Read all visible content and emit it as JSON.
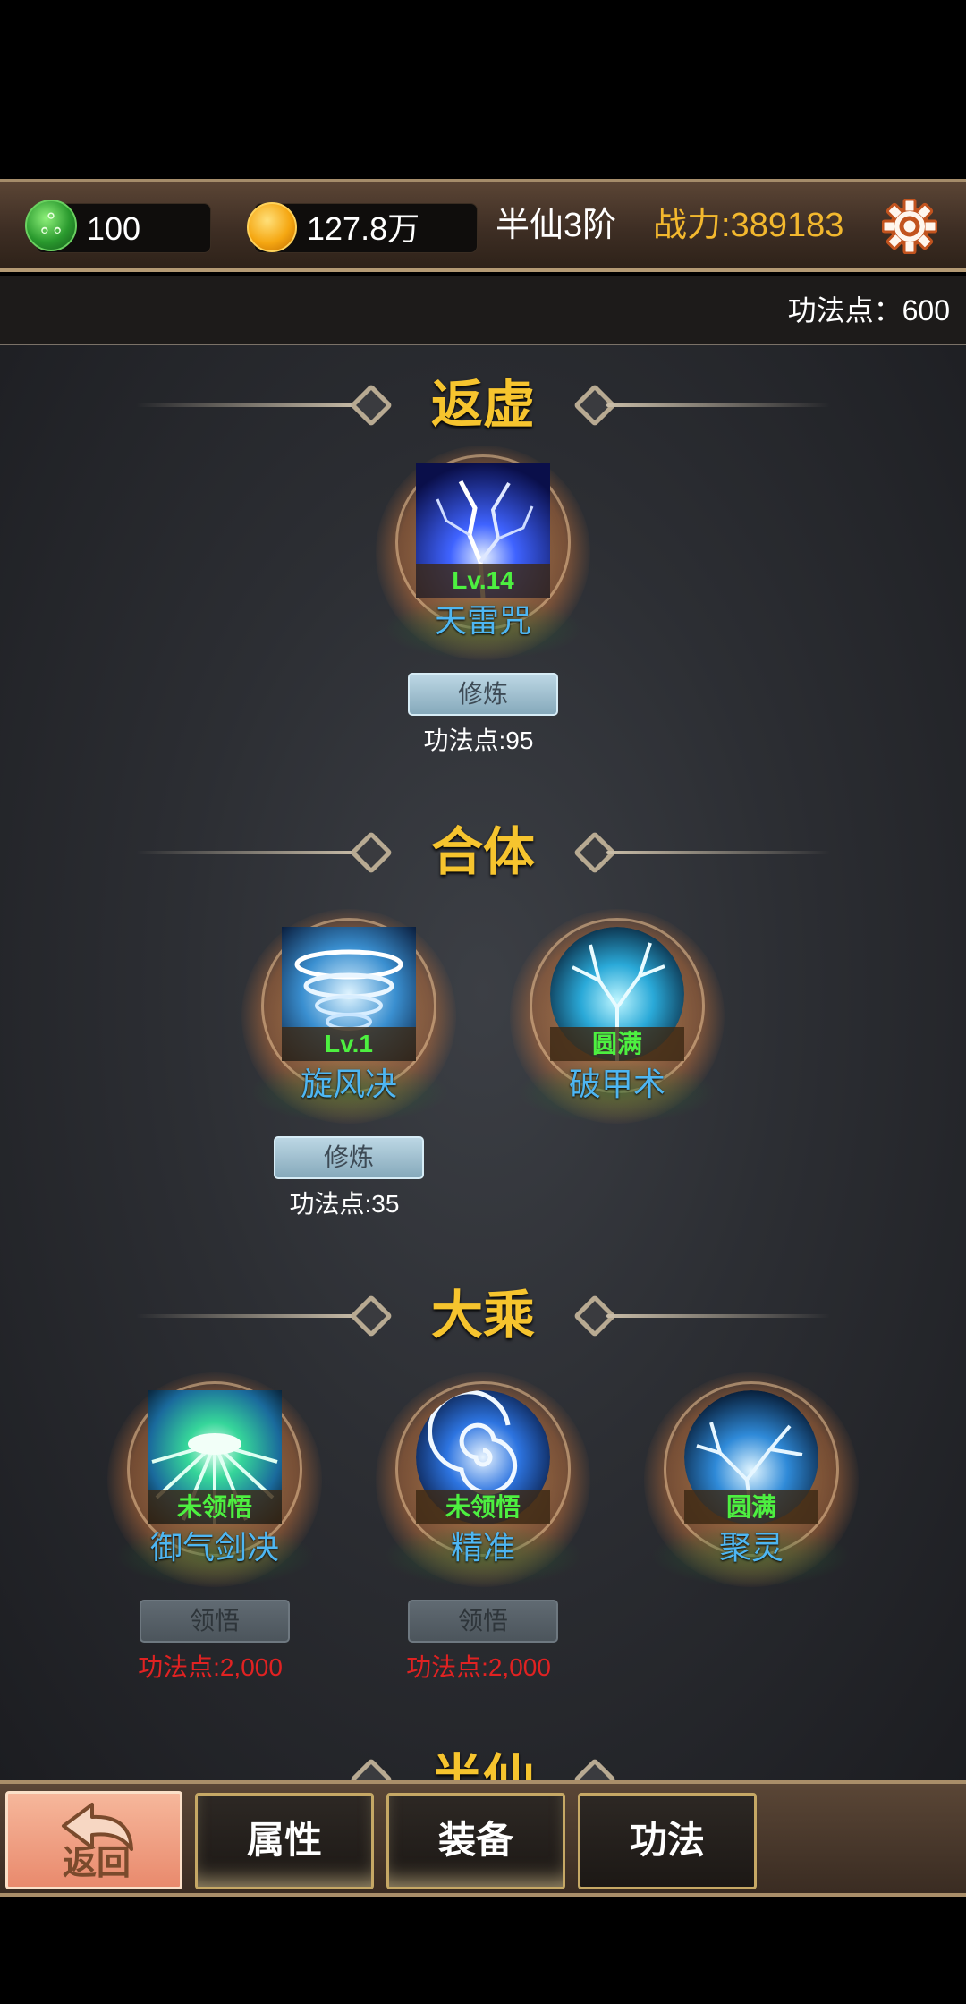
{
  "header": {
    "jade_amount": "100",
    "gold_amount": "127.8万",
    "realm": "半仙3阶",
    "combat_power": "战力:389183"
  },
  "points_label": "功法点：600",
  "tiers": [
    {
      "name": "返虚",
      "skills": [
        {
          "name": "天雷咒",
          "status": "Lv.14",
          "button": "修炼",
          "cost": "功法点:95"
        }
      ]
    },
    {
      "name": "合体",
      "skills": [
        {
          "name": "旋风决",
          "status": "Lv.1",
          "button": "修炼",
          "cost": "功法点:35"
        },
        {
          "name": "破甲术",
          "status": "圆满"
        }
      ]
    },
    {
      "name": "大乘",
      "skills": [
        {
          "name": "御气剑决",
          "status": "未领悟",
          "button": "领悟",
          "cost": "功法点:2,000"
        },
        {
          "name": "精准",
          "status": "未领悟",
          "button": "领悟",
          "cost": "功法点:2,000"
        },
        {
          "name": "聚灵",
          "status": "圆满"
        }
      ]
    },
    {
      "name": "半仙"
    }
  ],
  "nav": {
    "back": "返回",
    "tabs": [
      "属性",
      "装备",
      "功法"
    ]
  },
  "colors": {
    "tier_title": "#f6c42e",
    "skill_name": "#4eb6f2",
    "status_green": "#4df040",
    "cost_red": "#e02222",
    "power_gold": "#f3b82e"
  }
}
